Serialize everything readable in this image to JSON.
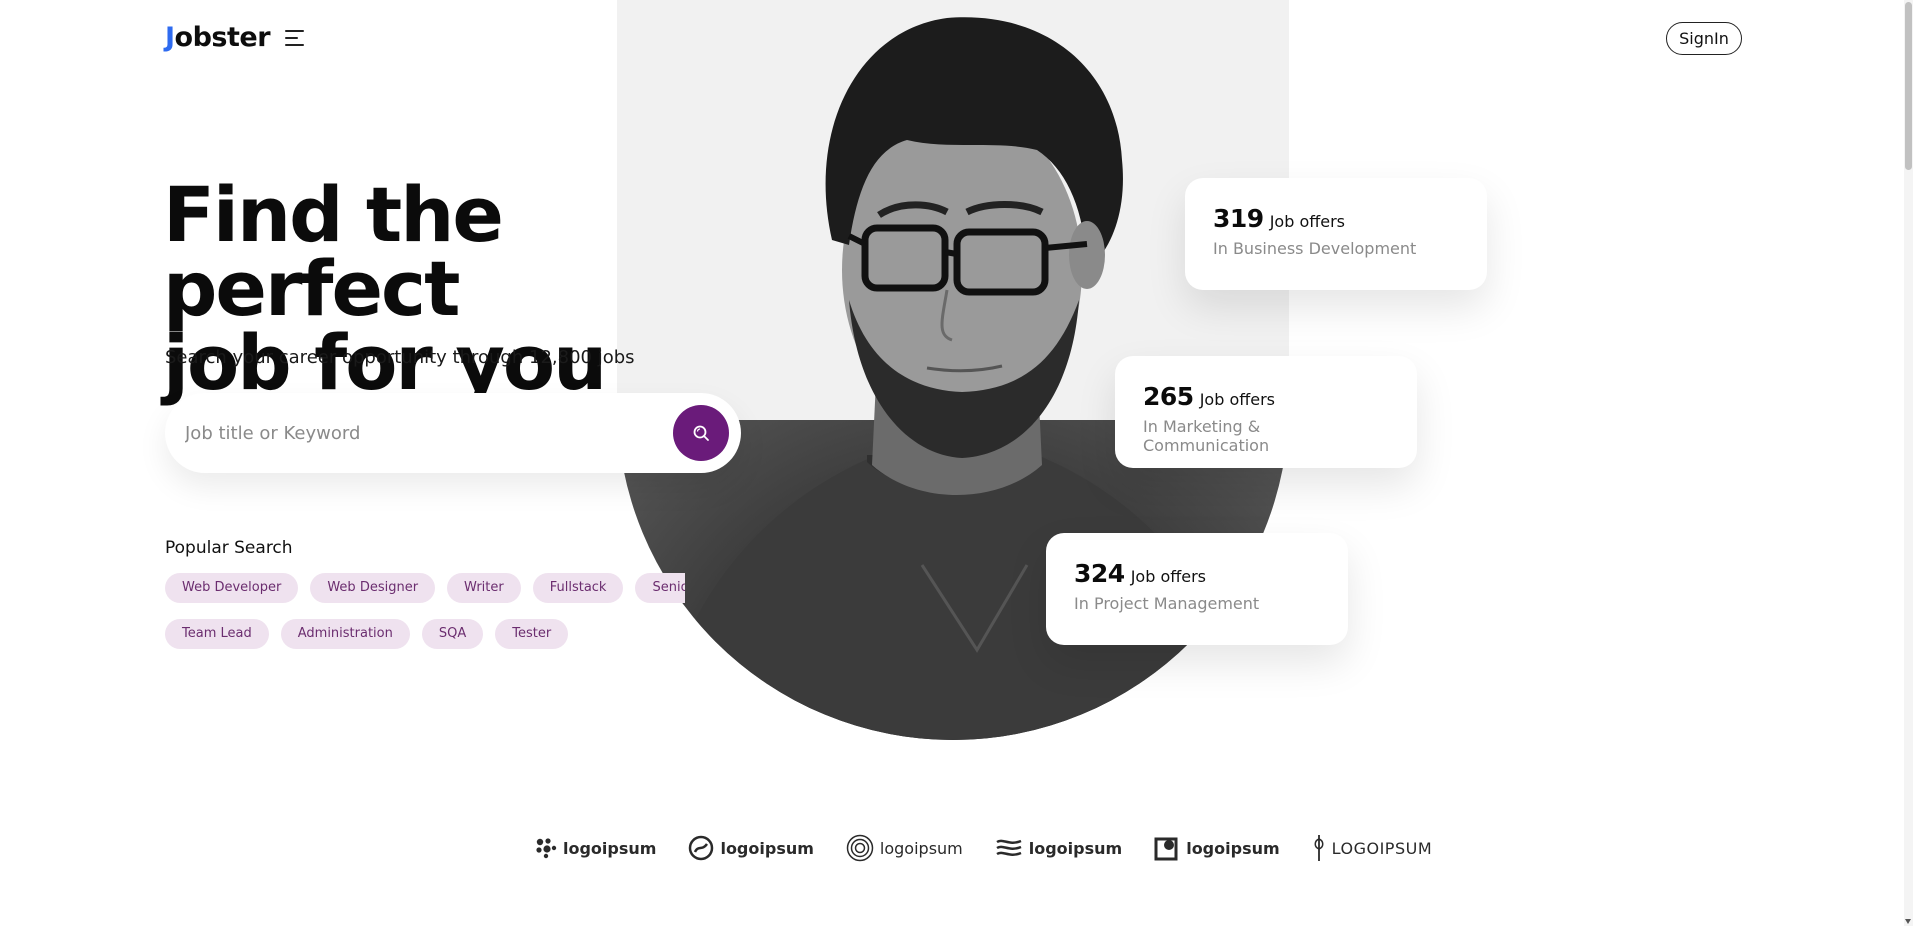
{
  "header": {
    "logo_first": "J",
    "logo_rest": "obster",
    "signin_label": "SignIn"
  },
  "hero": {
    "headline_line1": "Find the perfect",
    "headline_line2": "job for you",
    "subline": "Search your career opportunity through 12,800 jobs"
  },
  "search": {
    "placeholder": "Job title or Keyword"
  },
  "popular": {
    "title": "Popular Search",
    "row1": [
      "Web Developer",
      "Web Designer",
      "Writer",
      "Fullstack",
      "Senior"
    ],
    "row2": [
      "Team Lead",
      "Administration",
      "SQA",
      "Tester"
    ]
  },
  "offers": [
    {
      "count": "319",
      "label": "Job offers",
      "category": "In Business Development"
    },
    {
      "count": "265",
      "label": "Job offers",
      "category": "In Marketing & Communication"
    },
    {
      "count": "324",
      "label": "Job offers",
      "category": "In Project Management"
    }
  ],
  "brand_logos": [
    {
      "icon": "logoipsum-dots-icon",
      "text": "logoipsum"
    },
    {
      "icon": "logoipsum-swirl-icon",
      "text": "logoipsum"
    },
    {
      "icon": "logoipsum-rings-icon",
      "text": "logoipsum"
    },
    {
      "icon": "logoipsum-waves-icon",
      "text": "logoipsum"
    },
    {
      "icon": "logoipsum-square-icon",
      "text": "logoipsum"
    },
    {
      "icon": "logoipsum-leaf-icon",
      "text": "LOGOIPSUM"
    }
  ],
  "colors": {
    "accent": "#6a1b7a",
    "logo_accent": "#2e6bf0",
    "tag_bg": "#efe2ef",
    "tag_text": "#6b2d6f"
  }
}
